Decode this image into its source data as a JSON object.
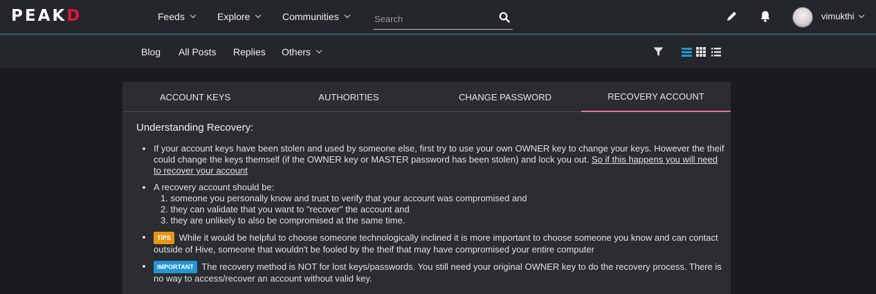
{
  "header": {
    "logo_main": "PEAK",
    "logo_accent": "D",
    "nav": [
      {
        "label": "Feeds"
      },
      {
        "label": "Explore"
      },
      {
        "label": "Communities"
      }
    ],
    "search": {
      "placeholder": "Search"
    },
    "username": "vimukthi"
  },
  "subnav": {
    "items": [
      {
        "label": "Blog"
      },
      {
        "label": "All Posts"
      },
      {
        "label": "Replies"
      },
      {
        "label": "Others"
      }
    ],
    "accent_color": "#2196d3"
  },
  "tabs": [
    {
      "label": "ACCOUNT KEYS"
    },
    {
      "label": "AUTHORITIES"
    },
    {
      "label": "CHANGE PASSWORD"
    },
    {
      "label": "RECOVERY ACCOUNT",
      "active": true
    }
  ],
  "content": {
    "heading": "Understanding Recovery:",
    "bullet1_text": "If your account keys have been stolen and used by someone else, first try to use your own OWNER key to change your keys. However the theif could change the keys themself (if the OWNER key or MASTER password has been stolen) and lock you out.",
    "bullet1_link": "So if this happens you will need to recover your account",
    "bullet2_intro": "A recovery account should be:",
    "bullet2_items": [
      "1. someone you personally know and trust to verify that your account was compromised and",
      "2. they can validate that you want to \"recover\" the account and",
      "3. they are unlikely to also be compromised at the same time."
    ],
    "tips_badge": "TIPS",
    "tips_text": "While it would be helpful to choose someone technologically inclined it is more important to choose someone you know and can contact outside of Hive, someone that wouldn't be fooled by the theif that may have compromised your entire computer",
    "important_badge": "IMPORTANT",
    "important_text": "The recovery method is NOT for lost keys/passwords. You still need your original OWNER key to do the recovery process. There is no way to access/recover an account without valid key."
  },
  "colors": {
    "brand_red": "#e31337",
    "tab_active_underline": "#e86f9a",
    "tips": "#e89514",
    "important": "#2196d3"
  }
}
